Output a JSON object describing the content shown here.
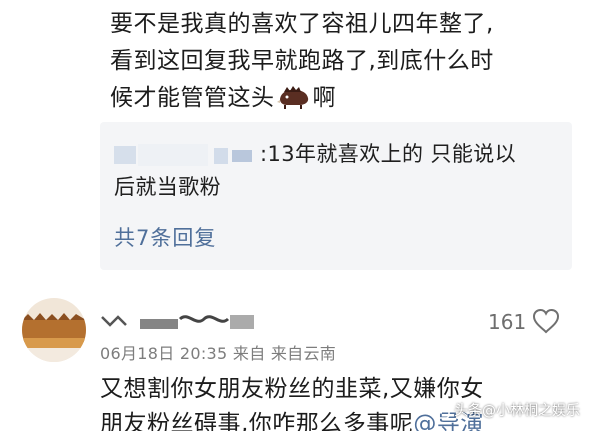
{
  "comment": {
    "text_line1": "要不是我真的喜欢了容祖儿四年整了,",
    "text_line2": "看到这回复我早就跑路了,到底什么时",
    "text_line3_before": "候才能管管这头",
    "text_line3_after": "啊",
    "inline_icon": "boar-icon"
  },
  "reply": {
    "text_line1": ":13年就喜欢上的 只能说以",
    "text_line2": "后就当歌粉",
    "count_label": "共7条回复"
  },
  "second_comment": {
    "likes": "161",
    "meta": "06月18日 20:35 来自 来自云南",
    "text_line1": "又想割你女朋友粉丝的韭菜,又嫌你女",
    "text_line2_before": "朋友粉丝碍事,你咋那么多事呢",
    "mention": "@导演"
  },
  "watermark": {
    "text": "头条@小林桐之娱乐"
  },
  "colors": {
    "link": "#4f6f9a",
    "reply_bg": "#f4f5f7",
    "meta": "#7d7d7d"
  }
}
